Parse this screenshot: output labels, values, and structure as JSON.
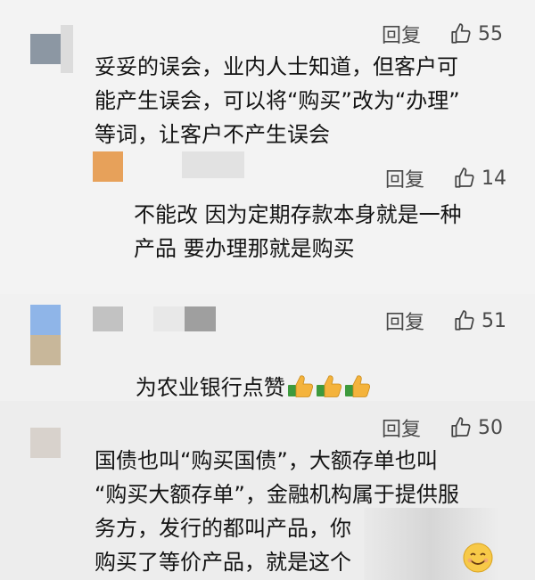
{
  "comments": [
    {
      "reply_label": "回复",
      "likes": "55",
      "text": "妥妥的误会，业内人士知道，但客户可\n能产生误会，可以将“购买”改为“办理”\n等词，让客户不产生误会",
      "avatar_color": "#8c97a3"
    },
    {
      "reply_label": "回复",
      "likes": "14",
      "text": "不能改 因为定期存款本身就是一种\n产品 要办理那就是购买",
      "avatar_color": "#e7a15a"
    },
    {
      "reply_label": "回复",
      "likes": "51",
      "text": "为农业银行点赞",
      "emoji_icons": [
        "thumbs-up-icon",
        "thumbs-up-icon",
        "thumbs-up-icon"
      ],
      "avatar_color": "#8fb5e8"
    },
    {
      "reply_label": "回复",
      "likes": "50",
      "text": "国债也叫“购买国债”，大额存单也叫\n“购买大额存单”，金融机构属于提供服\n务方，发行的都叫产品，你\n购买了等价产品，就是这个",
      "emoji_icon": "smiley-icon",
      "avatar_color": "#d8d2cc"
    }
  ],
  "icons": {
    "like": "thumb-up-outline-icon"
  }
}
